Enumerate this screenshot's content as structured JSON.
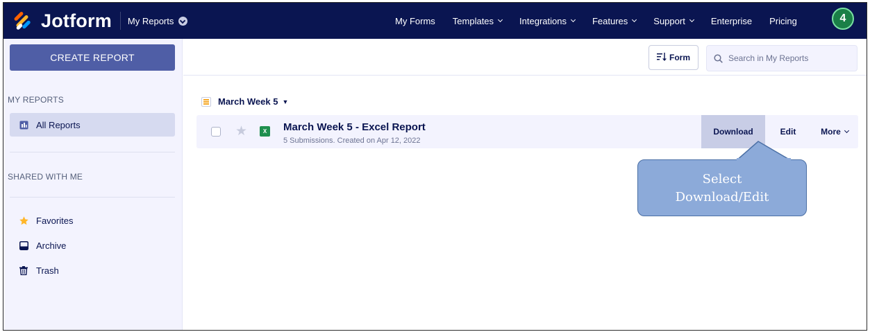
{
  "topnav": {
    "brand": "Jotform",
    "section": "My Reports",
    "links": [
      {
        "label": "My Forms",
        "has_dropdown": false
      },
      {
        "label": "Templates",
        "has_dropdown": true
      },
      {
        "label": "Integrations",
        "has_dropdown": true
      },
      {
        "label": "Features",
        "has_dropdown": true
      },
      {
        "label": "Support",
        "has_dropdown": true
      },
      {
        "label": "Enterprise",
        "has_dropdown": false
      },
      {
        "label": "Pricing",
        "has_dropdown": false
      }
    ],
    "avatar_text": "4"
  },
  "sidebar": {
    "create_label": "CREATE REPORT",
    "my_reports_heading": "MY REPORTS",
    "all_reports_label": "All Reports",
    "shared_heading": "SHARED WITH ME",
    "items": [
      {
        "label": "Favorites",
        "icon": "star-icon"
      },
      {
        "label": "Archive",
        "icon": "archive-icon"
      },
      {
        "label": "Trash",
        "icon": "trash-icon"
      }
    ]
  },
  "toolbar": {
    "sort_label": "Form",
    "search_placeholder": "Search in My Reports"
  },
  "group": {
    "title": "March Week 5"
  },
  "report": {
    "title": "March Week 5 - Excel Report",
    "meta": "5 Submissions. Created on Apr 12, 2022",
    "icon": "excel-icon",
    "download_label": "Download",
    "edit_label": "Edit",
    "more_label": "More"
  },
  "callout": {
    "line1": "Select",
    "line2": "Download/Edit"
  },
  "colors": {
    "nav_bg": "#0a1551",
    "create_btn": "#4f5ea6",
    "sidebar_bg": "#f3f3fe",
    "download_bg": "#c8cde6",
    "callout_bg": "#8caad9",
    "avatar_bg": "#1a7f47"
  }
}
